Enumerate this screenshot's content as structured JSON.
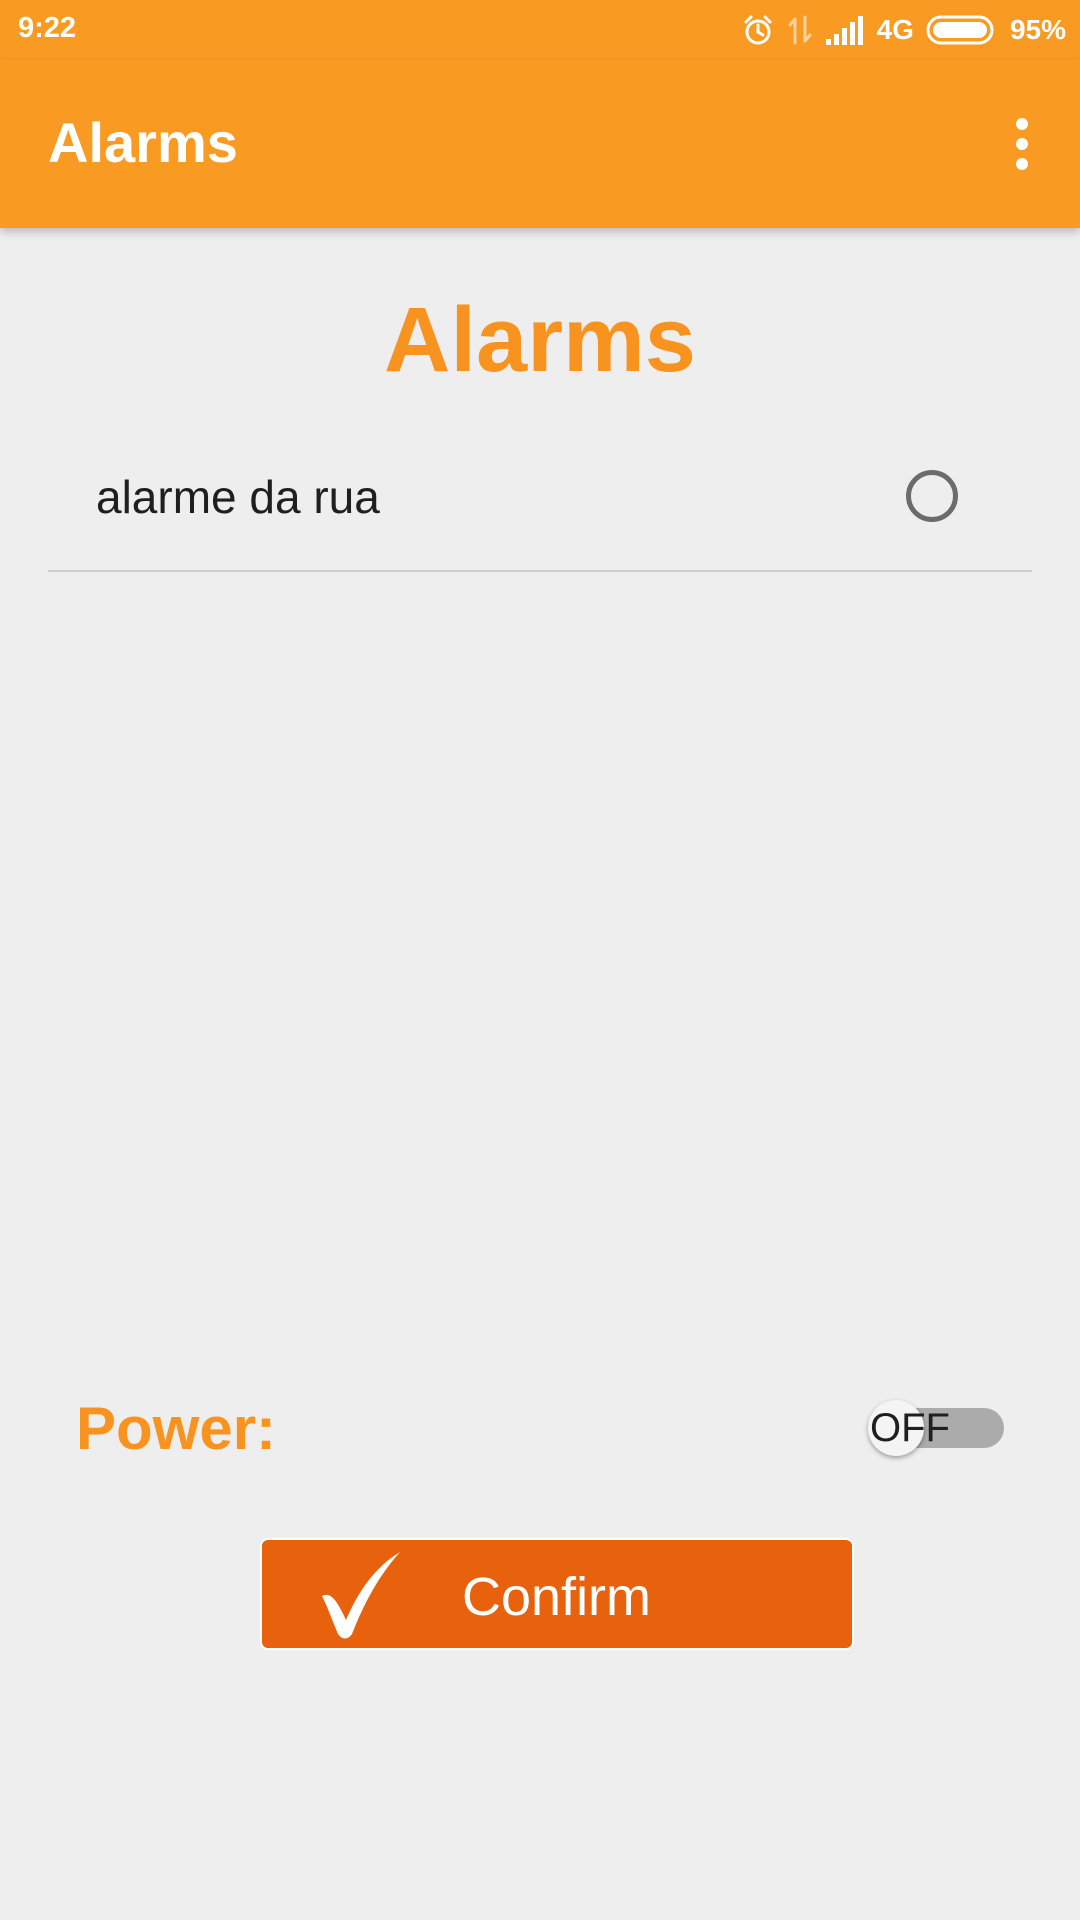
{
  "status_bar": {
    "time": "9:22",
    "network": "4G",
    "battery": "95%",
    "icons": [
      "alarm-clock-icon",
      "data-transfer-icon",
      "signal-icon",
      "battery-icon"
    ]
  },
  "app_bar": {
    "title": "Alarms",
    "menu_icon": "overflow-menu-icon"
  },
  "main": {
    "heading": "Alarms",
    "alarms": [
      {
        "name": "alarme da rua",
        "selected": false
      }
    ],
    "power": {
      "label": "Power:",
      "switch_text": "OFF",
      "on": false
    },
    "confirm_label": "Confirm"
  },
  "colors": {
    "primary": "#f99a22",
    "accent_text": "#f7931e",
    "confirm_button": "#e8610d",
    "background": "#eeeeef"
  }
}
